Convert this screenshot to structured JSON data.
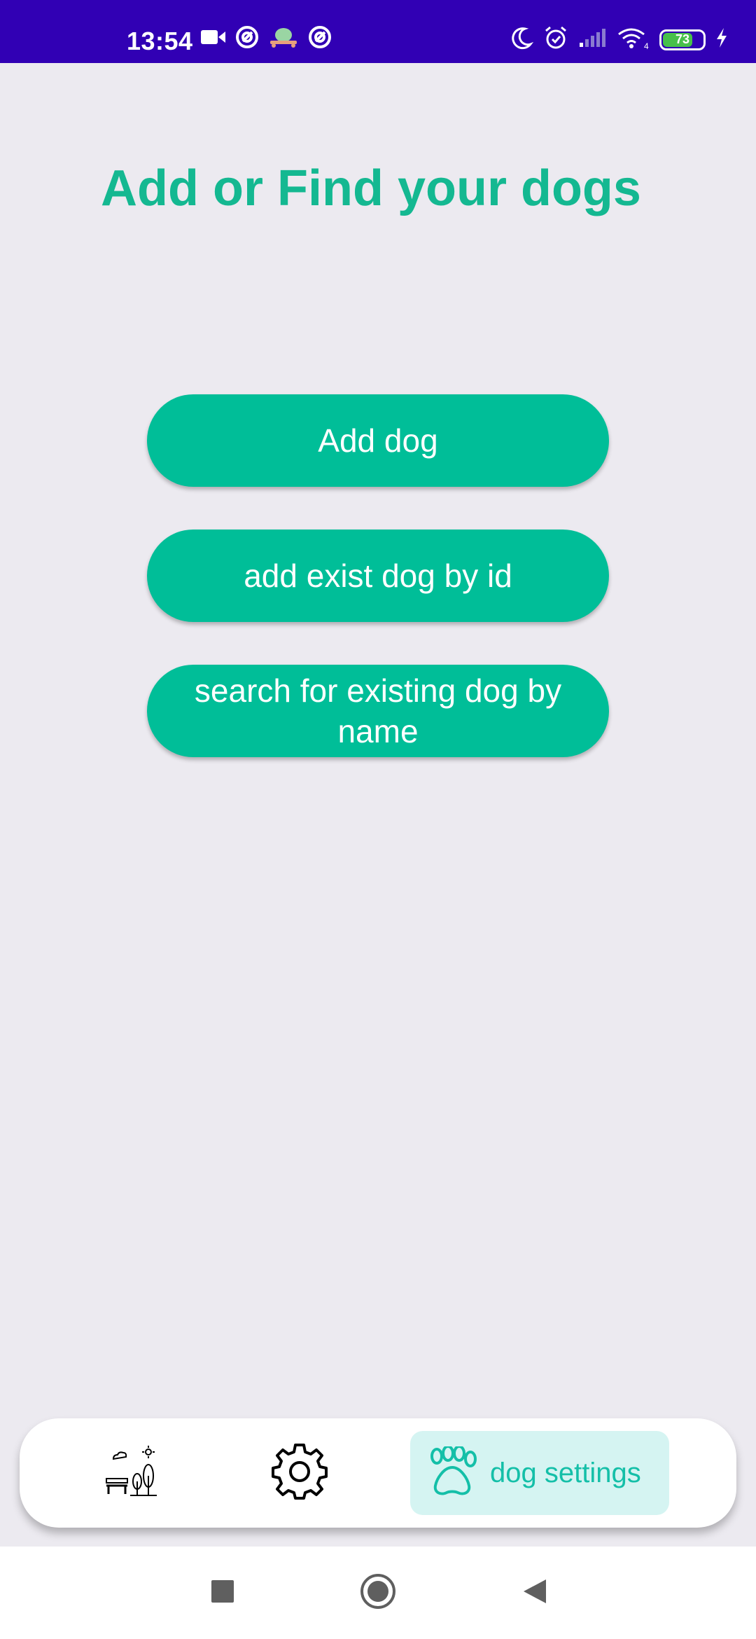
{
  "status_bar": {
    "time": "13:54",
    "battery_level": "73",
    "left_icons": [
      "video-camera-icon",
      "notification-app-icon",
      "game-app-icon",
      "notification-app-icon"
    ],
    "right_icons": [
      "do-not-disturb-moon-icon",
      "alarm-icon",
      "cellular-signal-icon",
      "wifi-icon",
      "battery-icon",
      "charging-bolt-icon"
    ],
    "background_color": "#3100B4"
  },
  "page": {
    "title": "Add or Find your dogs",
    "title_color": "#14B891",
    "background_color": "#ECEAF0"
  },
  "actions": {
    "add_dog": "Add dog",
    "add_exist_by_id": "add exist dog by id",
    "search_by_name": "search for existing dog by name",
    "button_color": "#00BE98"
  },
  "bottom_nav": {
    "items": [
      {
        "icon": "park-bench-trees-icon",
        "label": ""
      },
      {
        "icon": "gear-icon",
        "label": ""
      },
      {
        "icon": "paw-icon",
        "label": "dog settings",
        "selected": true
      }
    ],
    "selected_background": "#D5F4F2",
    "selected_color": "#14BFA8"
  },
  "system_nav": {
    "buttons": [
      "recents-square-icon",
      "home-circle-icon",
      "back-triangle-icon"
    ]
  }
}
